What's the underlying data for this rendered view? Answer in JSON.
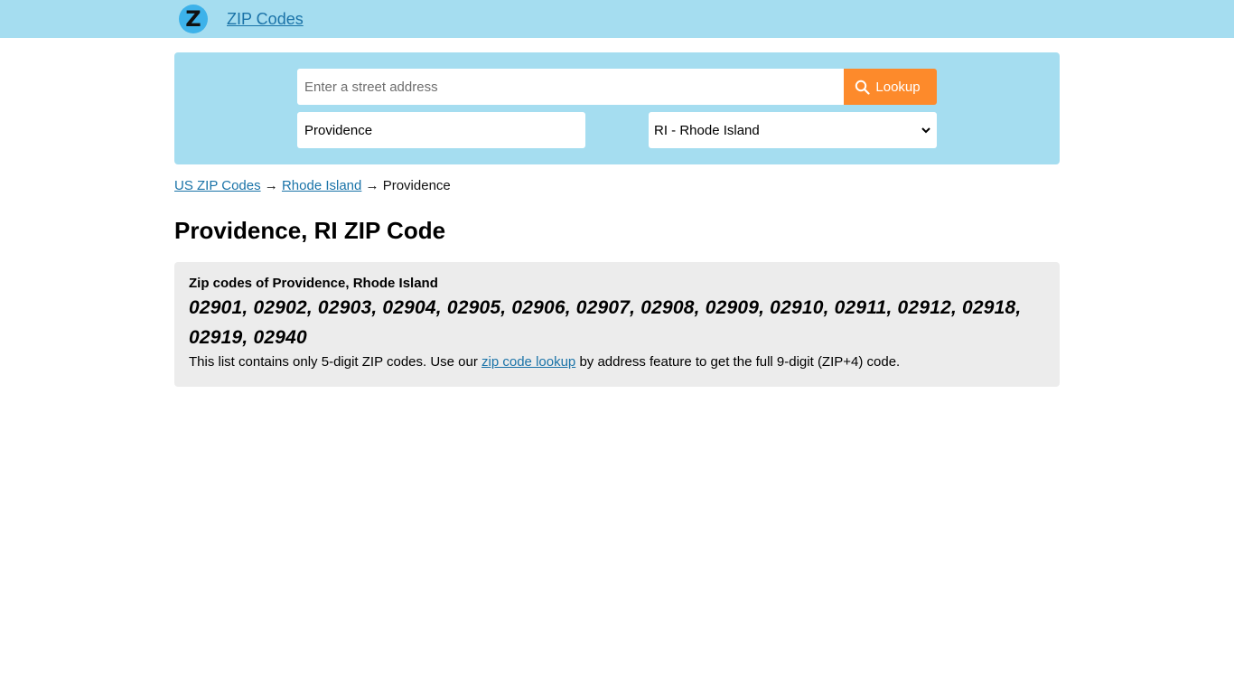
{
  "header": {
    "logo_letter": "Z",
    "site_link": "ZIP Codes"
  },
  "search": {
    "address_placeholder": "Enter a street address",
    "address_value": "",
    "lookup_label": "Lookup",
    "city_value": "Providence",
    "state_selected": "RI - Rhode Island"
  },
  "breadcrumb": {
    "home": "US ZIP Codes",
    "separator": "→",
    "state": "Rhode Island",
    "current": "Providence"
  },
  "page_title": "Providence, RI ZIP Code",
  "zip_section": {
    "heading": "Zip codes of Providence, Rhode Island",
    "codes": "02901, 02902, 02903, 02904, 02905, 02906, 02907, 02908, 02909, 02910, 02911, 02912, 02918, 02919, 02940",
    "note_before": "This list contains only 5-digit ZIP codes. Use our ",
    "note_link": "zip code lookup",
    "note_after": " by address feature to get the full 9-digit (ZIP+4) code."
  },
  "colors": {
    "header_bg": "#a5ddf0",
    "logo_bg": "#3db2ea",
    "lookup_button": "#fd8a2b",
    "link": "#1a73a8",
    "zip_box_bg": "#ececec"
  },
  "icons": {
    "lookup": "search-icon",
    "select": "chevron-down-icon"
  }
}
